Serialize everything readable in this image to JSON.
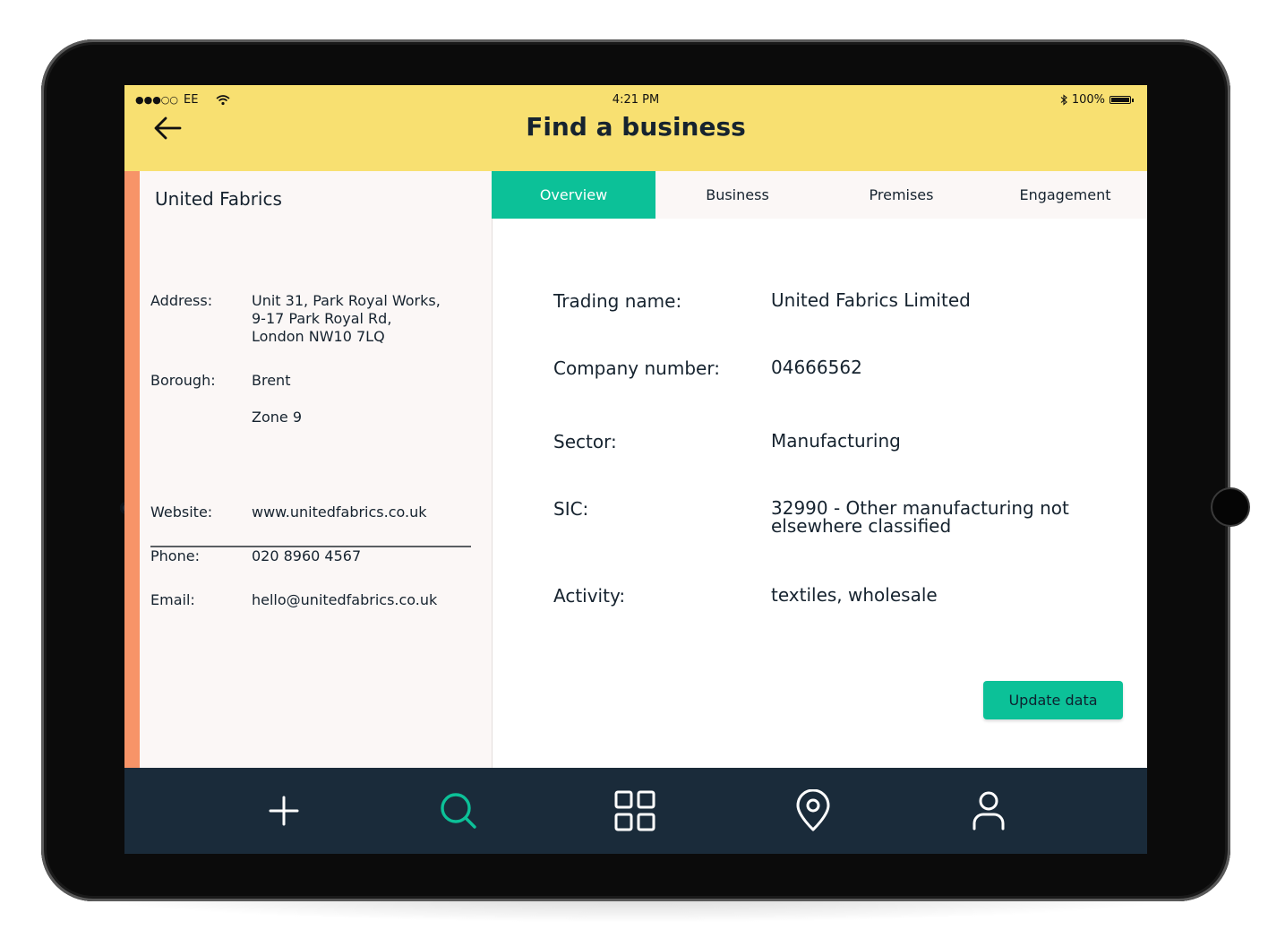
{
  "status_bar": {
    "carrier": "EE",
    "time": "4:21 PM",
    "battery": "100%"
  },
  "header": {
    "title": "Find a business"
  },
  "business": {
    "name": "United Fabrics",
    "address_label": "Address:",
    "address_lines": [
      "Unit 31, Park Royal Works,",
      "9-17 Park Royal Rd,",
      "London NW10 7LQ"
    ],
    "borough_label": "Borough:",
    "borough": "Brent",
    "zone": "Zone 9",
    "website_label": "Website:",
    "website": "www.unitedfabrics.co.uk",
    "phone_label": "Phone:",
    "phone": "020 8960 4567",
    "email_label": "Email:",
    "email": "hello@unitedfabrics.co.uk"
  },
  "tabs": [
    {
      "label": "Overview",
      "active": true
    },
    {
      "label": "Business",
      "active": false
    },
    {
      "label": "Premises",
      "active": false
    },
    {
      "label": "Engagement",
      "active": false
    }
  ],
  "overview": {
    "trading_name_label": "Trading name:",
    "trading_name": "United Fabrics Limited",
    "company_number_label": "Company number:",
    "company_number": "04666562",
    "sector_label": "Sector:",
    "sector": "Manufacturing",
    "sic_label": "SIC:",
    "sic_lines": [
      "32990 - Other manufacturing not",
      "elsewhere classified"
    ],
    "activity_label": "Activity:",
    "activity": "textiles, wholesale",
    "update_button": "Update data"
  },
  "bottom_nav": {
    "items": [
      {
        "icon": "plus-icon"
      },
      {
        "icon": "search-icon",
        "active": true
      },
      {
        "icon": "grid-icon"
      },
      {
        "icon": "location-pin-icon"
      },
      {
        "icon": "user-icon"
      }
    ]
  },
  "colors": {
    "header_bg": "#f8e071",
    "accent": "#0cc198",
    "left_accent": "#f79468",
    "nav_bg": "#1a2b3a"
  }
}
